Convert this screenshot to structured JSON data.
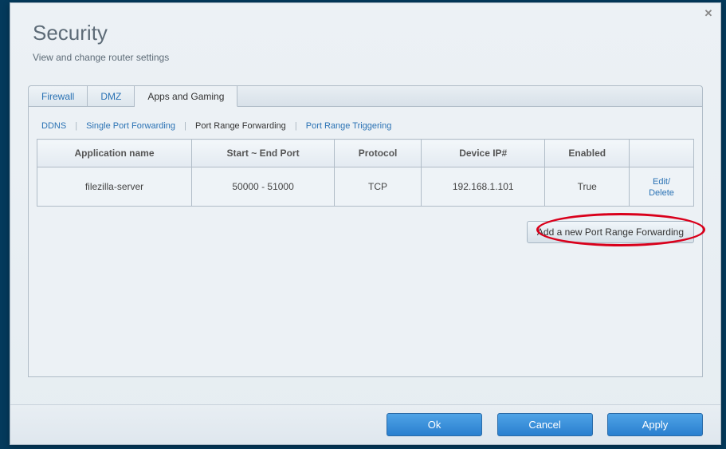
{
  "header": {
    "title": "Security",
    "subtitle": "View and change router settings"
  },
  "tabs": {
    "firewall": "Firewall",
    "dmz": "DMZ",
    "apps": "Apps and Gaming"
  },
  "subtabs": {
    "ddns": "DDNS",
    "single": "Single Port Forwarding",
    "range": "Port Range Forwarding",
    "trigger": "Port Range Triggering"
  },
  "table": {
    "headers": {
      "app": "Application name",
      "ports": "Start ~ End Port",
      "proto": "Protocol",
      "ip": "Device IP#",
      "enabled": "Enabled",
      "actions": ""
    },
    "rows": [
      {
        "app": "filezilla-server",
        "ports": "50000 - 51000",
        "proto": "TCP",
        "ip": "192.168.1.101",
        "enabled": "True",
        "edit": "Edit/",
        "delete": "Delete"
      }
    ]
  },
  "buttons": {
    "add": "Add a new Port Range Forwarding",
    "ok": "Ok",
    "cancel": "Cancel",
    "apply": "Apply"
  }
}
